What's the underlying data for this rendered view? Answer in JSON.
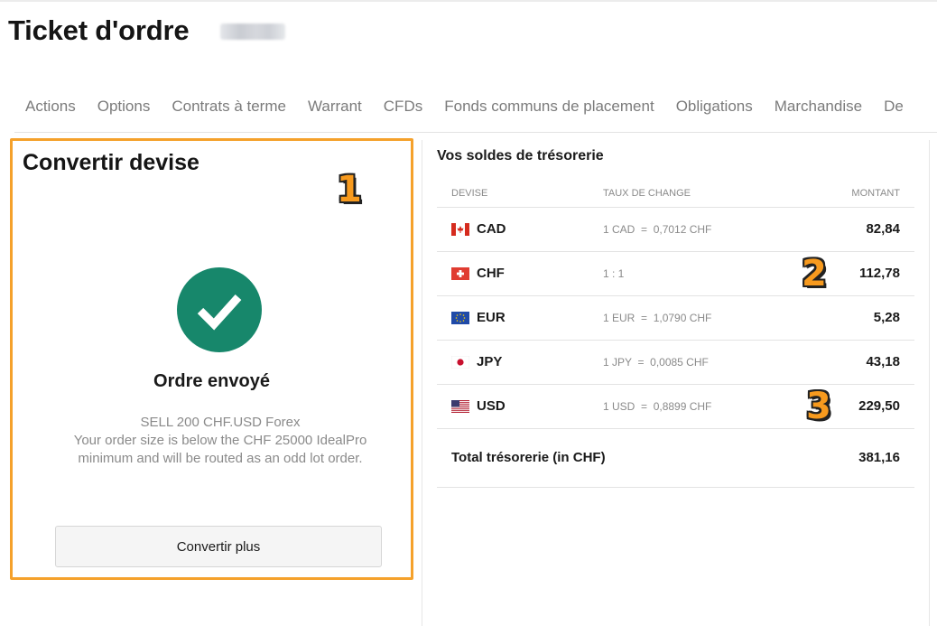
{
  "header": {
    "title": "Ticket d'ordre"
  },
  "tabs": [
    {
      "label": "Actions"
    },
    {
      "label": "Options"
    },
    {
      "label": "Contrats à terme"
    },
    {
      "label": "Warrant"
    },
    {
      "label": "CFDs"
    },
    {
      "label": "Fonds communs de placement"
    },
    {
      "label": "Obligations"
    },
    {
      "label": "Marchandise"
    },
    {
      "label": "De"
    }
  ],
  "convert_panel": {
    "title": "Convertir devise",
    "status_icon": "check-circle-icon",
    "status_color": "#17876b",
    "status_title": "Ordre envoyé",
    "order_lines": [
      "SELL 200 CHF.USD Forex",
      "Your order size is below the CHF 25000 IdealPro",
      "minimum and will be routed as an odd lot order."
    ],
    "convert_more_label": "Convertir plus"
  },
  "callouts": {
    "one": "1",
    "two": "2",
    "three": "3",
    "color": "#f79a1e"
  },
  "balances": {
    "title": "Vos soldes de trésorerie",
    "columns": {
      "currency": "DEVISE",
      "rate": "TAUX DE CHANGE",
      "amount": "MONTANT"
    },
    "rows": [
      {
        "flag": "flag-canada-icon",
        "currency": "CAD",
        "rate": "1 CAD  =  0,7012 CHF",
        "amount": "82,84"
      },
      {
        "flag": "flag-switzerland-icon",
        "currency": "CHF",
        "rate": "1 : 1",
        "amount": "112,78"
      },
      {
        "flag": "flag-eu-icon",
        "currency": "EUR",
        "rate": "1 EUR  =  1,0790 CHF",
        "amount": "5,28"
      },
      {
        "flag": "flag-japan-icon",
        "currency": "JPY",
        "rate": "1 JPY  =  0,0085 CHF",
        "amount": "43,18"
      },
      {
        "flag": "flag-usa-icon",
        "currency": "USD",
        "rate": "1 USD  =  0,8899 CHF",
        "amount": "229,50"
      }
    ],
    "total_label": "Total trésorerie (in CHF)",
    "total_value": "381,16"
  },
  "colors": {
    "accent_border": "#f5a12b",
    "success": "#17876b"
  }
}
